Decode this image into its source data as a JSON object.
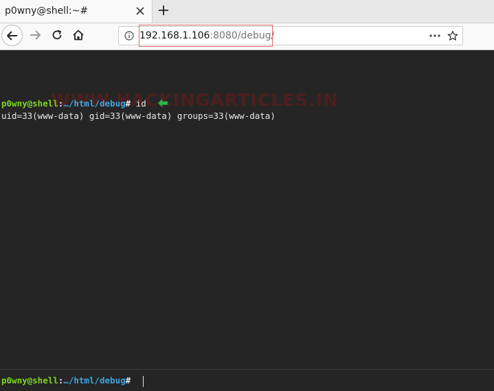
{
  "tab": {
    "title": "p0wny@shell:~#"
  },
  "urlbar": {
    "host": "192.168.1.106",
    "port_path": ":8080/debug/"
  },
  "watermark": "WWW.HACKINGARTICLES.IN",
  "terminal": {
    "history": [
      {
        "user": "p0wny@shell",
        "sep": ":",
        "path": "…/html/debug",
        "hash": "#",
        "command": " id"
      }
    ],
    "output": "uid=33(www-data) gid=33(www-data) groups=33(www-data)",
    "input_prompt": {
      "user": "p0wny@shell",
      "sep": ":",
      "path": "…/html/debug",
      "hash": "#"
    }
  },
  "colors": {
    "prompt_user": "#7ed321",
    "prompt_path": "#3aa6e0",
    "terminal_bg": "#252525",
    "highlight_box": "#e06464",
    "arrow": "#2fb44a"
  }
}
